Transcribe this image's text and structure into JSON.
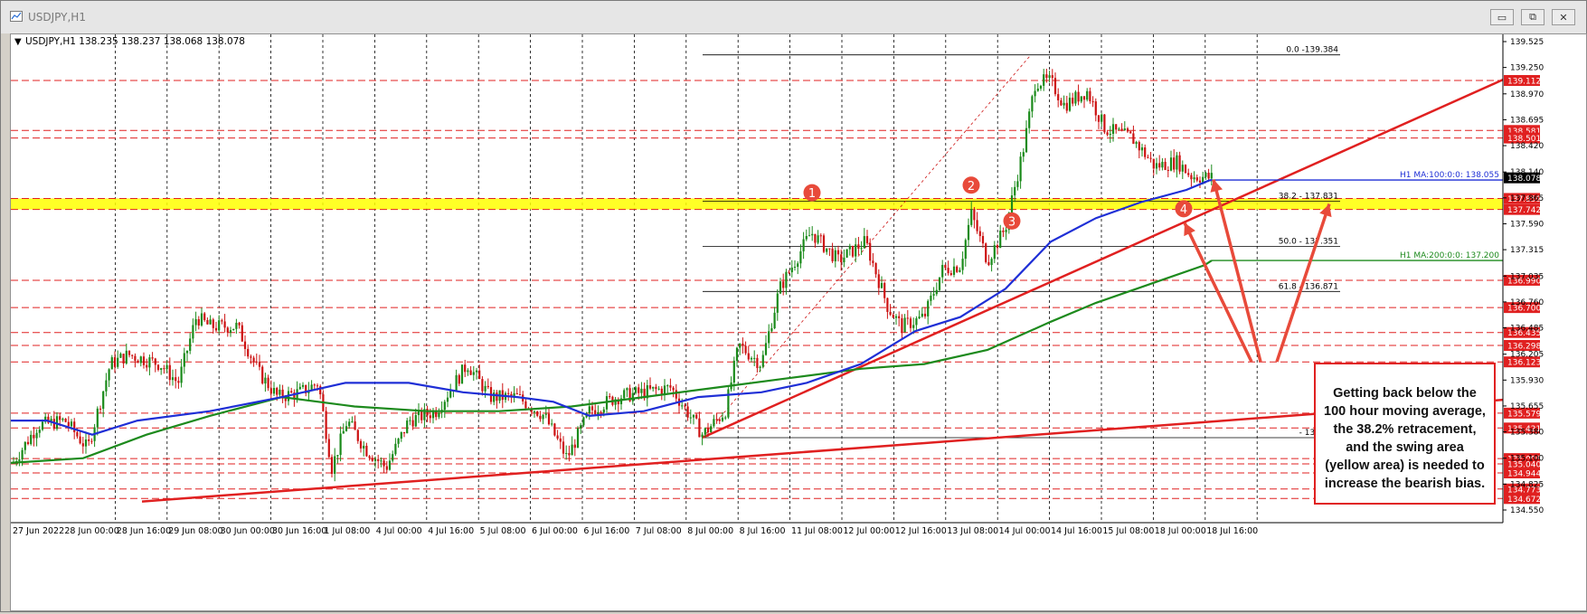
{
  "window": {
    "title": "USDJPY,H1",
    "controls": {
      "minimize": "▭",
      "restore": "⧉",
      "close": "✕"
    }
  },
  "chart": {
    "header": "USDJPY,H1  138.235 138.237 138.068 138.078",
    "menu_arrow": "▼"
  },
  "chart_data": {
    "type": "candlestick",
    "symbol": "USDJPY",
    "timeframe": "H1",
    "ohlc_current": {
      "open": 138.235,
      "high": 138.237,
      "low": 138.068,
      "close": 138.078
    },
    "ylim": [
      134.5,
      139.6
    ],
    "x_tick_labels": [
      "27 Jun 2022",
      "28 Jun 00:00",
      "28 Jun 16:00",
      "29 Jun 08:00",
      "30 Jun 00:00",
      "30 Jun 16:00",
      "1 Jul 08:00",
      "4 Jul 00:00",
      "4 Jul 16:00",
      "5 Jul 08:00",
      "6 Jul 00:00",
      "6 Jul 16:00",
      "7 Jul 08:00",
      "8 Jul 00:00",
      "8 Jul 16:00",
      "11 Jul 08:00",
      "12 Jul 00:00",
      "12 Jul 16:00",
      "13 Jul 08:00",
      "14 Jul 00:00",
      "14 Jul 16:00",
      "15 Jul 08:00",
      "18 Jul 00:00",
      "18 Jul 16:00"
    ],
    "y_tick_labels": [
      "139.525",
      "139.250",
      "138.970",
      "138.695",
      "138.420",
      "138.140",
      "137.865",
      "137.590",
      "137.315",
      "137.035",
      "136.760",
      "136.485",
      "136.205",
      "135.930",
      "135.655",
      "135.380",
      "135.100",
      "134.825",
      "134.550"
    ],
    "horizontal_levels": [
      {
        "label": "139.112",
        "value": 139.112
      },
      {
        "label": "138.581",
        "value": 138.581
      },
      {
        "label": "138.501",
        "value": 138.501
      },
      {
        "label": "137.859",
        "value": 137.859
      },
      {
        "label": "137.742",
        "value": 137.742
      },
      {
        "label": "136.990",
        "value": 136.99
      },
      {
        "label": "136.700",
        "value": 136.7
      },
      {
        "label": "136.435",
        "value": 136.435
      },
      {
        "label": "136.298",
        "value": 136.298
      },
      {
        "label": "136.123",
        "value": 136.123
      },
      {
        "label": "135.579",
        "value": 135.579
      },
      {
        "label": "135.421",
        "value": 135.421
      },
      {
        "label": "135.096",
        "value": 135.096
      },
      {
        "label": "135.040",
        "value": 135.04
      },
      {
        "label": "134.944",
        "value": 134.944
      },
      {
        "label": "134.773",
        "value": 134.773
      },
      {
        "label": "134.672",
        "value": 134.672
      }
    ],
    "fibonacci": [
      {
        "label": "0.0 -139.384",
        "value": 139.384
      },
      {
        "label": "38.2 - 137.831",
        "value": 137.831
      },
      {
        "label": "50.0 - 137.351",
        "value": 137.351
      },
      {
        "label": "61.8 - 136.871",
        "value": 136.871
      },
      {
        "label": "- 135.318",
        "value": 135.318
      }
    ],
    "moving_averages": [
      {
        "label": "H1 MA:100:0:0: 138.055",
        "value": 138.055,
        "color": "#1f2fd6"
      },
      {
        "label": "H1 MA:200:0:0: 137.200",
        "value": 137.2,
        "color": "#1d8a1d"
      }
    ],
    "current_price": {
      "label": "138.078",
      "value": 138.078
    },
    "swing_area": {
      "top": 137.859,
      "bottom": 137.742,
      "color": "#ffff00"
    },
    "swing_markers": [
      "1",
      "2",
      "3",
      "4"
    ]
  },
  "annotation": {
    "lines": [
      "Getting back below the",
      "100 hour moving average,",
      "the 38.2% retracement,",
      "and the swing area",
      "(yellow area) is needed to",
      "increase the bearish bias."
    ]
  },
  "colors": {
    "bull_candle": "#1a8a1a",
    "bear_candle": "#cc1111",
    "level_line": "#e02020",
    "trendline": "#e02020"
  }
}
